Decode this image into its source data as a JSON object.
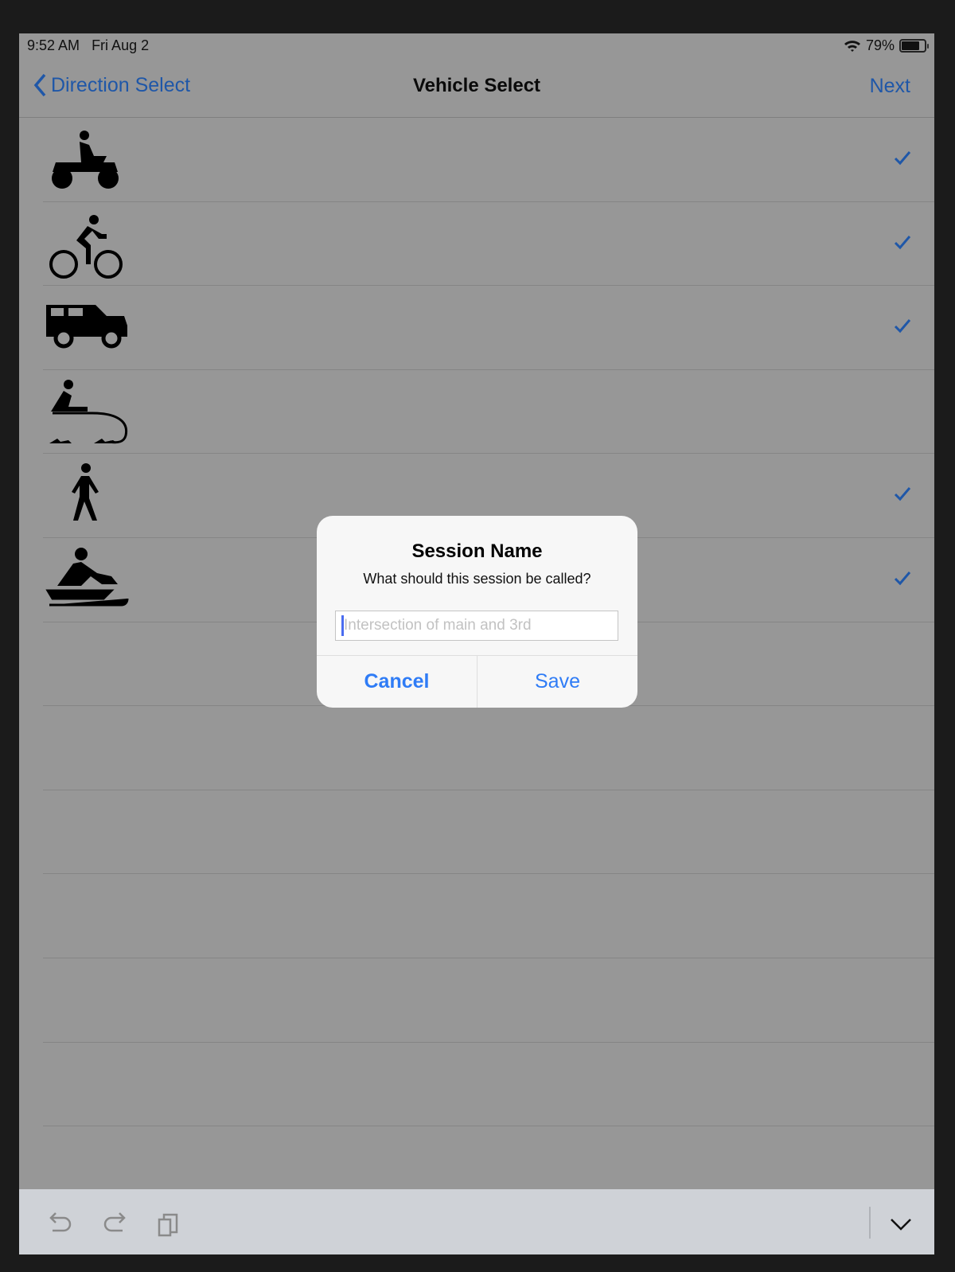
{
  "status": {
    "time": "9:52 AM",
    "date": "Fri Aug 2",
    "battery": "79%",
    "battery_level": 0.79
  },
  "nav": {
    "back_label": "Direction Select",
    "title": "Vehicle Select",
    "next_label": "Next"
  },
  "vehicles": [
    {
      "icon": "atv-icon",
      "checked": true
    },
    {
      "icon": "bicycle-icon",
      "checked": true
    },
    {
      "icon": "jeep-icon",
      "checked": true
    },
    {
      "icon": "dog-sled-icon",
      "checked": false
    },
    {
      "icon": "pedestrian-icon",
      "checked": true
    },
    {
      "icon": "snowmobile-icon",
      "checked": true
    }
  ],
  "empty_rows": 7,
  "dialog": {
    "title": "Session Name",
    "message": "What should this session be called?",
    "placeholder": "Intersection of main and 3rd",
    "value": "",
    "cancel_label": "Cancel",
    "save_label": "Save"
  },
  "colors": {
    "accent": "#2f7cf6",
    "dimmed_accent": "#1f57a8",
    "check": "#1f57a8"
  }
}
